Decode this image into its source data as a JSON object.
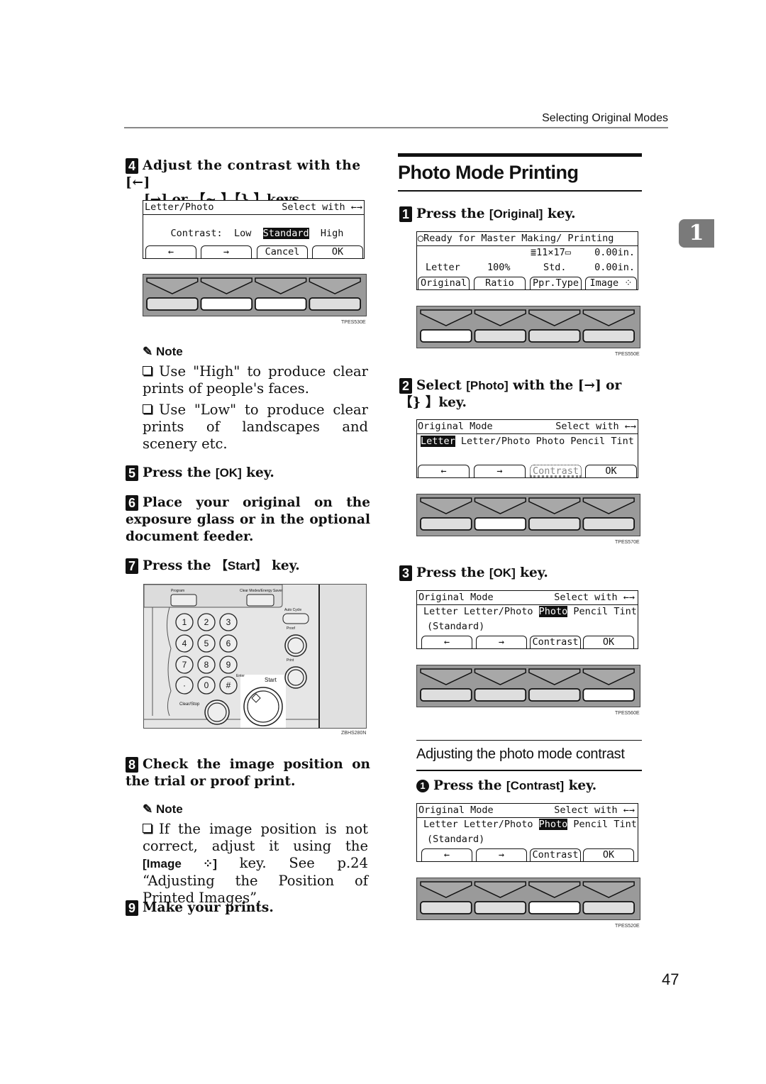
{
  "header": {
    "running_head": "Selecting Original Modes",
    "chapter_tab": "1"
  },
  "page_number": "47",
  "left_column": {
    "step4": {
      "num": "4",
      "text_a": "Adjust the contrast with the [←]",
      "text_b": "[→] or 【~ 】【} 】keys."
    },
    "lcd_contrast": {
      "title": "Letter/Photo",
      "hint": "Select with ←→",
      "label": "Contrast:",
      "options": [
        "Low",
        "Standard",
        "High"
      ],
      "selected": "Standard",
      "buttons": [
        "←",
        "→",
        "Cancel",
        "OK"
      ]
    },
    "keys_fig1": {
      "id": "TPES530E",
      "highlighted": [
        1,
        2
      ]
    },
    "note1": {
      "heading": "Note",
      "items": [
        "Use \"High\" to produce clear prints of people's faces.",
        "Use \"Low\" to produce clear prints of landscapes and scenery etc."
      ]
    },
    "step5": {
      "num": "5",
      "text": "Press the ",
      "key": "[OK]",
      "tail": " key."
    },
    "step6": {
      "num": "6",
      "text": "Place your original on the exposure glass or in the optional document feeder."
    },
    "step7": {
      "num": "7",
      "text": "Press the ",
      "key": "【Start】",
      "tail": " key."
    },
    "control_panel": {
      "id": "ZBHS280N",
      "labels": {
        "program": "Program",
        "clear_modes": "Clear Modes/Energy Saver",
        "auto_cycle": "Auto Cycle",
        "proof": "Proof",
        "print": "Print",
        "enter": "Enter",
        "start": "Start",
        "clear_stop": "Clear/Stop"
      },
      "keypad": [
        "1",
        "2",
        "3",
        "4",
        "5",
        "6",
        "7",
        "8",
        "9",
        "·",
        "0",
        "#"
      ]
    },
    "step8": {
      "num": "8",
      "text": "Check the image position on the trial or proof print."
    },
    "note2": {
      "heading": "Note",
      "item_a": "If the image position is not correct, adjust it using the ",
      "item_key": "[Image ⁘]",
      "item_b": " key. See p.24 “Adjusting the Position of Printed Images”."
    },
    "step9": {
      "num": "9",
      "text": "Make your prints."
    }
  },
  "right_column": {
    "title": "Photo Mode Printing",
    "step1": {
      "num": "1",
      "text": "Press the ",
      "key": "[Original]",
      "tail": " key."
    },
    "lcd_ready": {
      "status": "◯Ready for Master Making/ Printing",
      "paper": "≣11×17▭",
      "offset1": "0.00in.",
      "original": "Letter",
      "ratio": "100%",
      "paper_type": "Std.",
      "offset2": "0.00in.",
      "buttons": [
        "Original",
        "Ratio",
        "Ppr.Type",
        "Image ⁘"
      ]
    },
    "keys_fig2": {
      "id": "TPES550E",
      "highlighted": [
        0
      ]
    },
    "step2": {
      "num": "2",
      "text": "Select ",
      "key": "[Photo]",
      "tail": " with the [→] or 【} 】key."
    },
    "lcd_mode1": {
      "title": "Original Mode",
      "hint": "Select with ←→",
      "modes": [
        "Letter",
        "Letter/Photo",
        "Photo",
        "Pencil",
        "Tint"
      ],
      "selected": "Letter",
      "buttons": [
        "←",
        "→",
        "Contrast",
        "OK"
      ],
      "disabled_button": "Contrast"
    },
    "keys_fig3": {
      "id": "TPES570E",
      "highlighted": [
        1
      ]
    },
    "step3": {
      "num": "3",
      "text": "Press the ",
      "key": "[OK]",
      "tail": " key."
    },
    "lcd_mode2": {
      "title": "Original Mode",
      "hint": "Select with ←→",
      "modes": [
        "Letter",
        "Letter/Photo",
        "Photo",
        "Pencil",
        "Tint"
      ],
      "selected": "Photo",
      "sub": "(Standard)",
      "buttons": [
        "←",
        "→",
        "Contrast",
        "OK"
      ]
    },
    "keys_fig4": {
      "id": "TPES560E",
      "highlighted": [
        3
      ]
    },
    "subsection": "Adjusting the photo mode contrast",
    "substep1": {
      "num": "1",
      "text": "Press the ",
      "key": "[Contrast]",
      "tail": " key."
    },
    "lcd_mode3": {
      "title": "Original Mode",
      "hint": "Select with ←→",
      "modes": [
        "Letter",
        "Letter/Photo",
        "Photo",
        "Pencil",
        "Tint"
      ],
      "selected": "Photo",
      "sub": "(Standard)",
      "buttons": [
        "←",
        "→",
        "Contrast",
        "OK"
      ]
    },
    "keys_fig5": {
      "id": "TPES520E",
      "highlighted": [
        2
      ]
    }
  }
}
